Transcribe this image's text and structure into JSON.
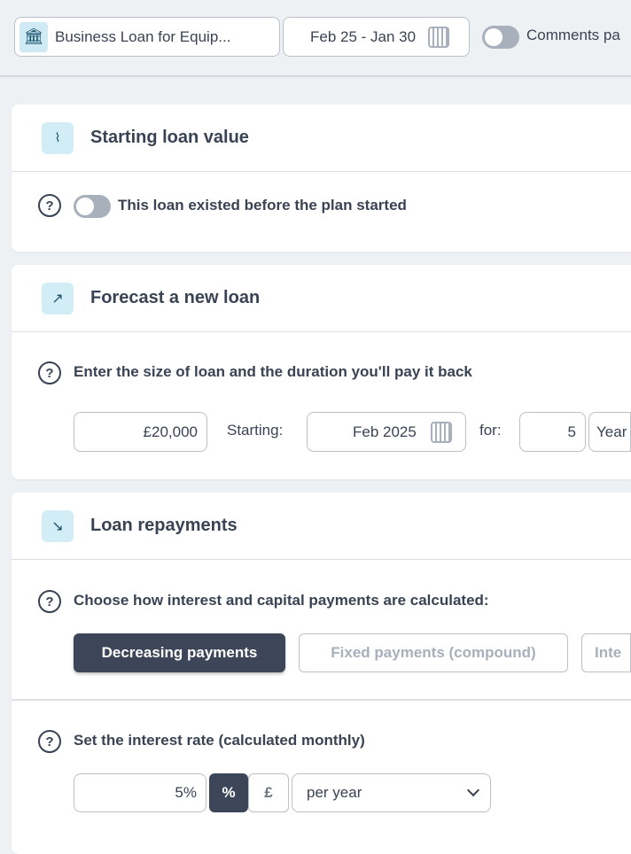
{
  "topbar": {
    "loan_name": "Business Loan for Equip...",
    "date_range": "Feb 25 - Jan 30",
    "comments_label": "Comments pa"
  },
  "starting": {
    "title": "Starting loan value",
    "toggle_label": "This loan existed before the plan started",
    "toggle_on": false
  },
  "forecast": {
    "title": "Forecast a new loan",
    "prompt": "Enter the size of loan and the duration you'll pay it back",
    "amount": "£20,000",
    "starting_label": "Starting:",
    "start_date": "Feb 2025",
    "for_label": "for:",
    "duration": "5",
    "duration_unit": "Year"
  },
  "repayments": {
    "title": "Loan repayments",
    "prompt": "Choose how interest and capital payments are calculated:",
    "options": [
      "Decreasing payments",
      "Fixed payments (compound)",
      "Inte"
    ],
    "selected": "Decreasing payments",
    "rate_prompt": "Set the interest rate (calculated monthly)",
    "rate": "5%",
    "percent_label": "%",
    "pound_label": "£",
    "period": "per year"
  }
}
